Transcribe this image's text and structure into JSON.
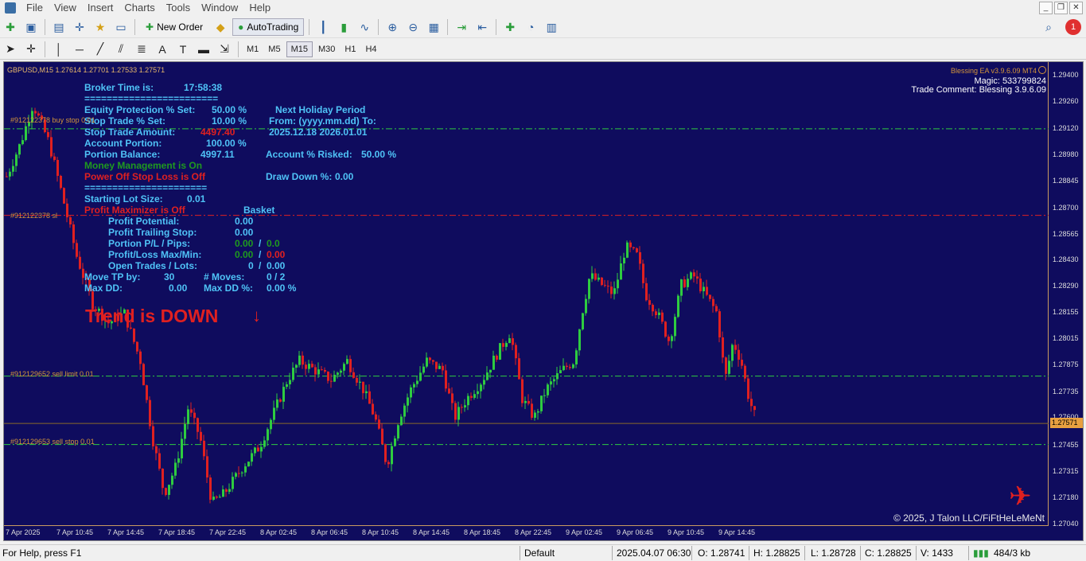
{
  "menu": {
    "items": [
      "File",
      "View",
      "Insert",
      "Charts",
      "Tools",
      "Window",
      "Help"
    ]
  },
  "toolbar": {
    "new_order": "New Order",
    "autotrading": "AutoTrading",
    "timeframes": [
      "M1",
      "M5",
      "M15",
      "M30",
      "H1",
      "H4"
    ],
    "active_timeframe": "M15"
  },
  "notification_count": "1",
  "chart": {
    "symbol_header": "GBPUSD,M15  1.27614 1.27701 1.27533 1.27571",
    "ea_name": "Blessing EA  v3.9.6.09 MT4",
    "magic": "Magic: 533799824",
    "trade_comment": "Trade Comment: Blessing 3.9.6.09",
    "copyright": "© 2025, J Talon LLC/FiFtHeLeMeNt",
    "current_price": "1.27571",
    "y_ticks": [
      "1.29400",
      "1.29260",
      "1.29120",
      "1.28980",
      "1.28845",
      "1.28700",
      "1.28565",
      "1.28430",
      "1.28290",
      "1.28155",
      "1.28015",
      "1.27875",
      "1.27735",
      "1.27600",
      "1.27455",
      "1.27315",
      "1.27180",
      "1.27040"
    ],
    "x_ticks": [
      "7 Apr 2025",
      "7 Apr 10:45",
      "7 Apr 14:45",
      "7 Apr 18:45",
      "7 Apr 22:45",
      "8 Apr 02:45",
      "8 Apr 06:45",
      "8 Apr 10:45",
      "8 Apr 14:45",
      "8 Apr 18:45",
      "8 Apr 22:45",
      "9 Apr 02:45",
      "9 Apr 06:45",
      "9 Apr 10:45",
      "9 Apr 14:45"
    ],
    "order_lines": [
      {
        "label": "#912122378 buy stop 0.01",
        "price": 1.2912,
        "color": "#2ecc40"
      },
      {
        "label": "#912122378 sl",
        "price": 1.28665,
        "color": "#e02020"
      },
      {
        "label": "#912129652 sell limit 0.01",
        "price": 1.2782,
        "color": "#2ecc40"
      },
      {
        "label": "#912129653 sell stop 0.01",
        "price": 1.2746,
        "color": "#2ecc40"
      }
    ]
  },
  "panel": {
    "broker_time_label": "Broker Time is:",
    "broker_time": "17:58:38",
    "sep1": "========================",
    "equity_label": "Equity Protection % Set:",
    "equity_value": "50.00 %",
    "stop_trade_pct_label": "Stop Trade % Set:",
    "stop_trade_pct_value": "10.00 %",
    "stop_trade_amt_label": "Stop Trade Amount:",
    "stop_trade_amt_value": "4497.40",
    "account_portion_label": "Account Portion:",
    "account_portion_value": "100.00 %",
    "portion_balance_label": "Portion Balance:",
    "portion_balance_value": "4997.11",
    "money_mgmt": "Money Management is On",
    "power_off": "Power Off Stop Loss is Off",
    "sep2": "======================",
    "start_lot_label": "Starting Lot Size:",
    "start_lot_value": "0.01",
    "profit_max": "Profit Maximizer is Off",
    "basket": "Basket",
    "profit_potential_label": "Profit Potential:",
    "profit_potential_value": "0.00",
    "profit_trailing_label": "Profit Trailing Stop:",
    "profit_trailing_value": "0.00",
    "portion_pl_label": "Portion P/L / Pips:",
    "portion_pl_value": "0.00",
    "portion_pips_value": "0.0",
    "pl_maxmin_label": "Profit/Loss Max/Min:",
    "pl_max": "0.00",
    "pl_min": "0.00",
    "open_trades_label": "Open Trades / Lots:",
    "open_trades_value": "0",
    "open_lots_value": "0.00",
    "move_tp_label": "Move TP by:",
    "move_tp_value": "30",
    "moves_label": "# Moves:",
    "moves_value": "0  /  2",
    "max_dd_label": "Max DD:",
    "max_dd_value": "0.00",
    "max_dd_pct_label": "Max DD %:",
    "max_dd_pct_value": "0.00 %",
    "holiday_title": "Next Holiday Period",
    "holiday_header": "From: (yyyy.mm.dd) To:",
    "holiday_dates": "2025.12.18  2026.01.01",
    "risked_label": "Account % Risked:",
    "risked_value": "50.00 %",
    "drawdown_label": "Draw Down %:",
    "drawdown_value": "0.00",
    "trend": "Trend is DOWN"
  },
  "status": {
    "help": "For Help, press F1",
    "profile": "Default",
    "datetime": "2025.04.07 06:30",
    "open": "O: 1.28741",
    "high": "H: 1.28825",
    "low": "L: 1.28728",
    "close": "C: 1.28825",
    "volume": "V: 1433",
    "traffic": "484/3 kb"
  }
}
